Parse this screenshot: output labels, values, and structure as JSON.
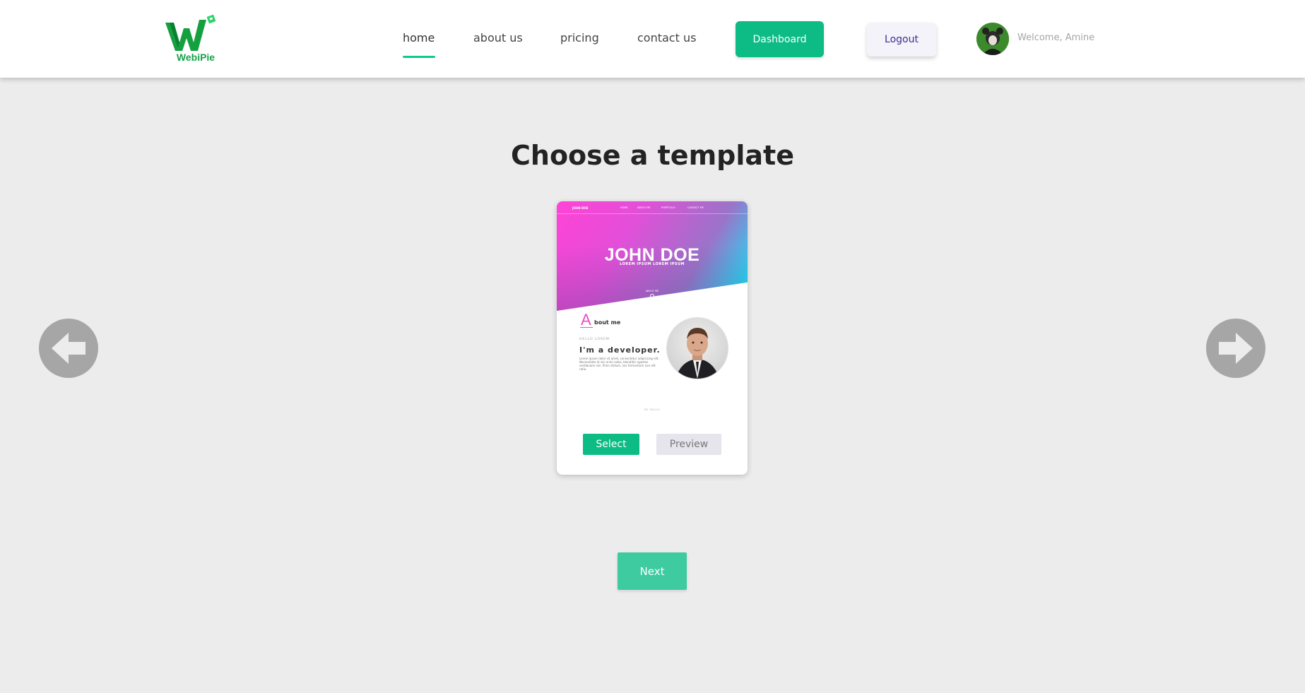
{
  "header": {
    "logo_text": "WebiPie",
    "nav": [
      {
        "label": "home",
        "active": true
      },
      {
        "label": "about us",
        "active": false
      },
      {
        "label": "pricing",
        "active": false
      },
      {
        "label": "contact us",
        "active": false
      }
    ],
    "dashboard_label": "Dashboard",
    "logout_label": "Logout",
    "welcome_text": "Welcome, Amine"
  },
  "main": {
    "title": "Choose a template",
    "template_card": {
      "preview": {
        "brand": "JOHN DOE",
        "nav": [
          "HOME",
          "ABOUT ME",
          "PORTFOLIO",
          "CONTACT ME"
        ],
        "hero_title": "JOHN DOE",
        "hero_subtitle": "LOREM IPSUM LOREM IPSUM",
        "hero_link": "ABOUT ME",
        "about_initial": "A",
        "about_rest": "bout me",
        "hello": "HELLO LOREM",
        "headline": "I'm a developer.",
        "body": "Lorem ipsum dolor sit amet, consectetur adipisicing elit. Necessitate id nisi enim nobis, blanditiis egestas vestibulum nisi. Proin dictum, nec fermentum non elit ratio.",
        "skills_label": "MY SKILLS"
      },
      "select_label": "Select",
      "preview_label": "Preview"
    },
    "next_label": "Next"
  },
  "colors": {
    "accent": "#0dbb84",
    "next": "#3ecb9f",
    "background": "#ececec",
    "arrow": "#a6a6a6",
    "logout_text": "#3b2e8f"
  },
  "icons": {
    "prev": "arrow-left-circle-icon",
    "next": "arrow-right-circle-icon"
  }
}
